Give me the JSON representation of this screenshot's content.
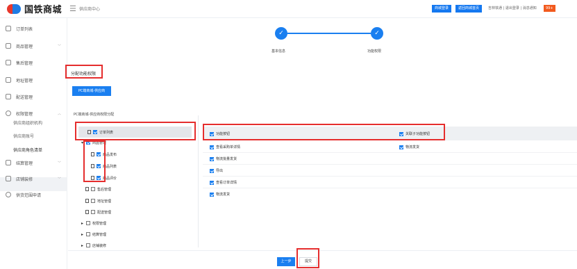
{
  "header": {
    "logo_text": "国铁商城",
    "breadcrumb": "供应商中心",
    "btn_login": "商城登录",
    "btn_home": "返回商城首页",
    "links": "吉林铁通 | 退出登录 | 消息通知",
    "badge": "99+"
  },
  "sidebar": {
    "items": [
      {
        "label": "订单列表"
      },
      {
        "label": "商品管理"
      },
      {
        "label": "售后管理"
      },
      {
        "label": "地址管理"
      },
      {
        "label": "配送管理"
      },
      {
        "label": "权限管理"
      },
      {
        "label": "结算管理"
      },
      {
        "label": "店铺装修"
      },
      {
        "label": "供货范围申请"
      }
    ],
    "sub_items": [
      "供应商组织机构",
      "供应商账号",
      "供应商角色清单"
    ]
  },
  "steps": {
    "step1": "基本信息",
    "step2": "功能权限",
    "check": "✓"
  },
  "section": {
    "title": "分配功能权限",
    "tab": "PC端商城-供应商",
    "perm_title": "PC端商城-供应商权限分配"
  },
  "tree": [
    {
      "label": "订单列表",
      "checked": true
    },
    {
      "label": "商品管理",
      "checked": true
    },
    {
      "label": "商品发布",
      "checked": true
    },
    {
      "label": "商品列表",
      "checked": true
    },
    {
      "label": "商品评价",
      "checked": true
    },
    {
      "label": "售后管理",
      "checked": false
    },
    {
      "label": "地址管理",
      "checked": false
    },
    {
      "label": "配送管理",
      "checked": false
    },
    {
      "label": "权限管理",
      "checked": false
    },
    {
      "label": "结算管理",
      "checked": false
    },
    {
      "label": "店铺装修",
      "checked": false
    }
  ],
  "permissions": {
    "head_left": "功能按钮",
    "head_right": "关联子功能按钮",
    "rows": [
      {
        "left": "查看采购单详情",
        "right": "物流发货"
      },
      {
        "left": "物流批量发货",
        "right": ""
      },
      {
        "left": "导出",
        "right": ""
      },
      {
        "left": "查看订单详情",
        "right": ""
      },
      {
        "left": "物流发货",
        "right": ""
      }
    ]
  },
  "footer": {
    "prev": "上一步",
    "submit": "提交"
  }
}
